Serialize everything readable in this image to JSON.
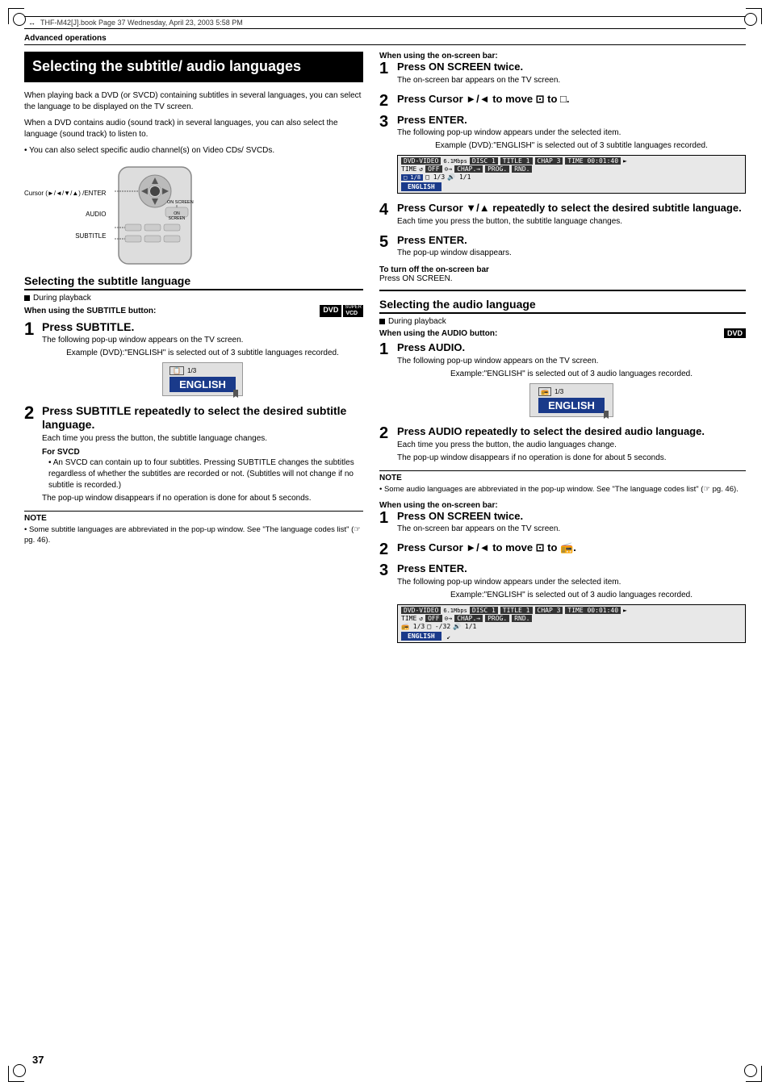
{
  "header": {
    "file": "THF-M42[J].book  Page 37  Wednesday, April 23, 2003  5:58 PM"
  },
  "page": {
    "sectionLabel": "Advanced operations",
    "title": "Selecting the subtitle/\naudio languages",
    "number": "37"
  },
  "left": {
    "intro1": "When playing back a DVD (or SVCD) containing subtitles in several languages, you can select the language to be displayed on the TV screen.",
    "intro2": "When a DVD contains audio (sound track) in several languages, you can also select the language (sound track) to listen to.",
    "introBullet": "You can also select specific audio channel(s) on Video CDs/ SVCDs.",
    "remote": {
      "cursorLabel": "Cursor\n(►/◄/▼/▲)\n/ENTER",
      "audioLabel": "AUDIO",
      "subtitleLabel": "SUBTITLE",
      "onScreenLabel": "ON SCREEN"
    },
    "subtitleSection": {
      "heading": "Selecting the subtitle language",
      "duringPlayback": "During playback",
      "whenLabel": "When using the SUBTITLE button:",
      "badge1": "DVD",
      "badge2": "VCD",
      "step1": {
        "title": "Press SUBTITLE.",
        "desc": "The following pop-up window appears on the TV screen.",
        "example": "Example (DVD):\"ENGLISH\" is selected out of 3 subtitle languages recorded."
      },
      "step2": {
        "title": "Press SUBTITLE repeatedly to select the desired subtitle language.",
        "desc": "Each time you press the button, the subtitle language changes.",
        "svcdLabel": "For SVCD",
        "svcdDesc": "An SVCD can contain up to four subtitles. Pressing SUBTITLE changes the subtitles regardless of whether the subtitles are recorded or not. (Subtitles will not change if no subtitle is recorded.)",
        "popupDisappear": "The pop-up window disappears if no operation is done for about 5 seconds."
      },
      "noteTitle": "NOTE",
      "noteText": "Some subtitle languages are abbreviated in the pop-up window. See \"The language codes list\" (☞ pg. 46)."
    }
  },
  "right": {
    "onscreenSubtitle": {
      "whenLabel": "When using the on-screen bar:",
      "step1": {
        "title": "Press ON SCREEN twice.",
        "desc": "The on-screen bar appears on the TV screen."
      },
      "step2": {
        "title": "Press Cursor ►/◄ to move ⊡ to □."
      },
      "step3": {
        "title": "Press ENTER.",
        "desc1": "The following pop-up window appears under the selected item.",
        "example": "Example (DVD):\"ENGLISH\" is selected out of 3 subtitle languages recorded."
      },
      "step4": {
        "title": "Press Cursor ▼/▲ repeatedly to select the desired subtitle language.",
        "desc": "Each time you press the button, the subtitle language changes."
      },
      "step5": {
        "title": "Press ENTER.",
        "desc": "The pop-up window disappears."
      },
      "turnOffTitle": "To turn off the on-screen bar",
      "turnOffDesc": "Press ON SCREEN."
    },
    "audioSection": {
      "heading": "Selecting the audio language",
      "duringPlayback": "During playback",
      "whenLabel": "When using the AUDIO button:",
      "badge": "DVD",
      "step1": {
        "title": "Press AUDIO.",
        "desc": "The following pop-up window appears on the TV screen.",
        "example": "Example:\"ENGLISH\" is selected out of 3 audio languages recorded."
      },
      "step2": {
        "title": "Press AUDIO repeatedly to select the desired audio language.",
        "desc1": "Each time you press the button, the audio languages change.",
        "desc2": "The pop-up window disappears if no operation is done for about 5 seconds."
      },
      "noteTitle": "NOTE",
      "noteText": "Some audio languages are abbreviated in the pop-up window. See \"The language codes list\" (☞ pg. 46)."
    },
    "onscreenAudio": {
      "whenLabel": "When using the on-screen bar:",
      "step1": {
        "title": "Press ON SCREEN twice.",
        "desc": "The on-screen bar appears on the TV screen."
      },
      "step2": {
        "title": "Press Cursor ►/◄ to move ⊡ to 📻."
      },
      "step3": {
        "title": "Press ENTER.",
        "desc1": "The following pop-up window appears under the selected item.",
        "example": "Example:\"ENGLISH\" is selected out of 3 audio languages recorded."
      }
    }
  }
}
